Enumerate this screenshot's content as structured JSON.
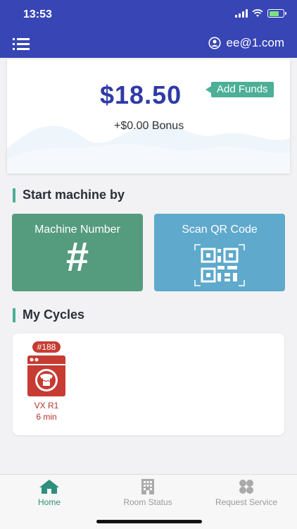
{
  "status_bar": {
    "time": "13:53"
  },
  "header": {
    "user_email": "ee@1.com"
  },
  "balance": {
    "amount": "$18.50",
    "add_funds_label": "Add Funds",
    "bonus": "+$0.00 Bonus"
  },
  "start_section": {
    "title": "Start machine by"
  },
  "tiles": {
    "machine_number": {
      "label": "Machine Number",
      "symbol": "#"
    },
    "scan_qr": {
      "label": "Scan QR Code"
    }
  },
  "cycles_section": {
    "title": "My Cycles"
  },
  "cycles": [
    {
      "badge": "#188",
      "name": "VX R1",
      "time": "6 min"
    }
  ],
  "tabs": {
    "home": "Home",
    "room_status": "Room Status",
    "request_service": "Request Service"
  },
  "colors": {
    "primary": "#3845b5",
    "accent_green": "#4caf98",
    "machine_tile": "#559b7e",
    "qr_tile": "#5ea9cc",
    "cycle_red": "#c63b32"
  }
}
